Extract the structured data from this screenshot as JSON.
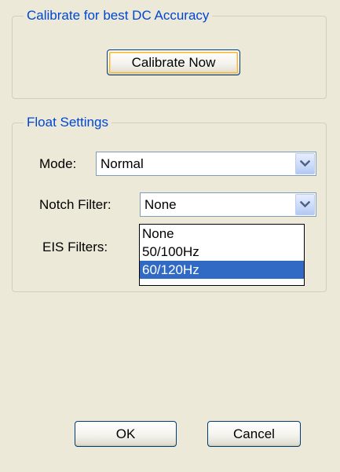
{
  "calibrate_group": {
    "title": "Calibrate for best DC Accuracy",
    "calibrate_button": "Calibrate Now"
  },
  "float_group": {
    "title": "Float Settings",
    "mode_label": "Mode:",
    "mode_value": "Normal",
    "notch_label": "Notch Filter:",
    "notch_value": "None",
    "eis_label": "EIS Filters:",
    "notch_options": [
      {
        "label": "None",
        "selected": false
      },
      {
        "label": "50/100Hz",
        "selected": false
      },
      {
        "label": "60/120Hz",
        "selected": true
      }
    ]
  },
  "footer": {
    "ok_label": "OK",
    "cancel_label": "Cancel"
  },
  "colors": {
    "dialog_bg": "#ece9d8",
    "group_title": "#0046d5",
    "selection": "#316ac5"
  },
  "icons": {
    "combo_arrow": "chevron-down-icon"
  }
}
